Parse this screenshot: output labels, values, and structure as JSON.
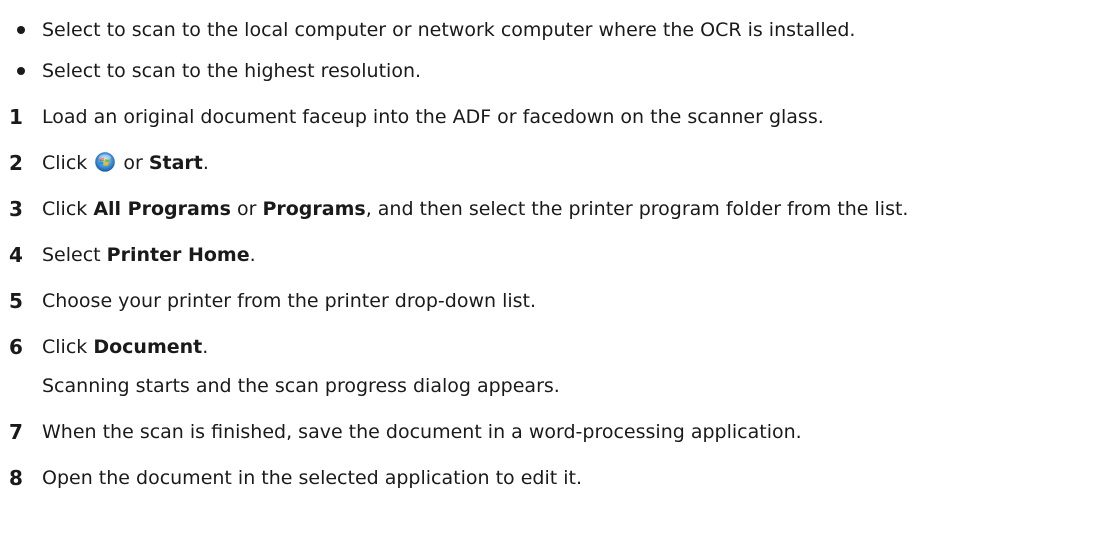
{
  "bullets": [
    {
      "text": "Select to scan to the local computer or network computer where the OCR is installed."
    },
    {
      "text": "Select to scan to the highest resolution."
    }
  ],
  "steps": [
    {
      "number": "1",
      "text": "Load an original document faceup into the ADF or facedown on the scanner glass."
    },
    {
      "number": "2",
      "pre": "Click",
      "icon": "windows-start-orb-icon",
      "mid": " or ",
      "bold": "Start",
      "post": "."
    },
    {
      "number": "3",
      "pre": "Click ",
      "bold1": "All Programs",
      "mid": " or ",
      "bold2": "Programs",
      "post": ", and then select the printer program folder from the list."
    },
    {
      "number": "4",
      "pre": "Select ",
      "bold": "Printer Home",
      "post": "."
    },
    {
      "number": "5",
      "text": "Choose your printer from the printer drop-down list."
    },
    {
      "number": "6",
      "pre": "Click ",
      "bold": "Document",
      "post": ".",
      "note": "Scanning starts and the scan progress dialog appears."
    },
    {
      "number": "7",
      "text": "When the scan is finished, save the document in a word-processing application."
    },
    {
      "number": "8",
      "text": "Open the document in the selected application to edit it."
    }
  ]
}
